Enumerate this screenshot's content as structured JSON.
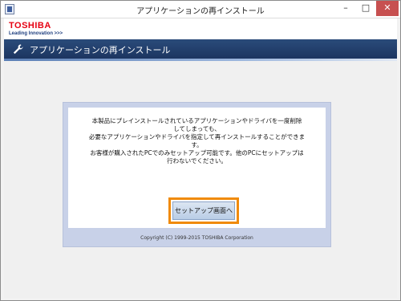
{
  "window": {
    "title": "アプリケーションの再インストール",
    "minimize_glyph": "–",
    "maximize_glyph": "□",
    "close_glyph": "✕"
  },
  "brand": {
    "logo": "TOSHIBA",
    "tagline": "Leading Innovation >>>",
    "logo_color": "#e60012"
  },
  "header": {
    "icon": "wrench-icon",
    "title": "アプリケーションの再インストール"
  },
  "message": {
    "lines": [
      "本製品にプレインストールされているアプリケーションやドライバを一度削除",
      "してしまっても、",
      "必要なアプリケーションやドライバを指定して再インストールすることができま",
      "す。",
      "お客様が購入されたPCでのみセットアップ可能です。他のPCにセットアップは",
      "行わないでください。"
    ]
  },
  "setup_button": {
    "label": "セットアップ画面へ",
    "highlight_color": "#f08a0a"
  },
  "footer": {
    "copyright": "Copyright (C) 1999-2015 TOSHIBA Corporation"
  }
}
